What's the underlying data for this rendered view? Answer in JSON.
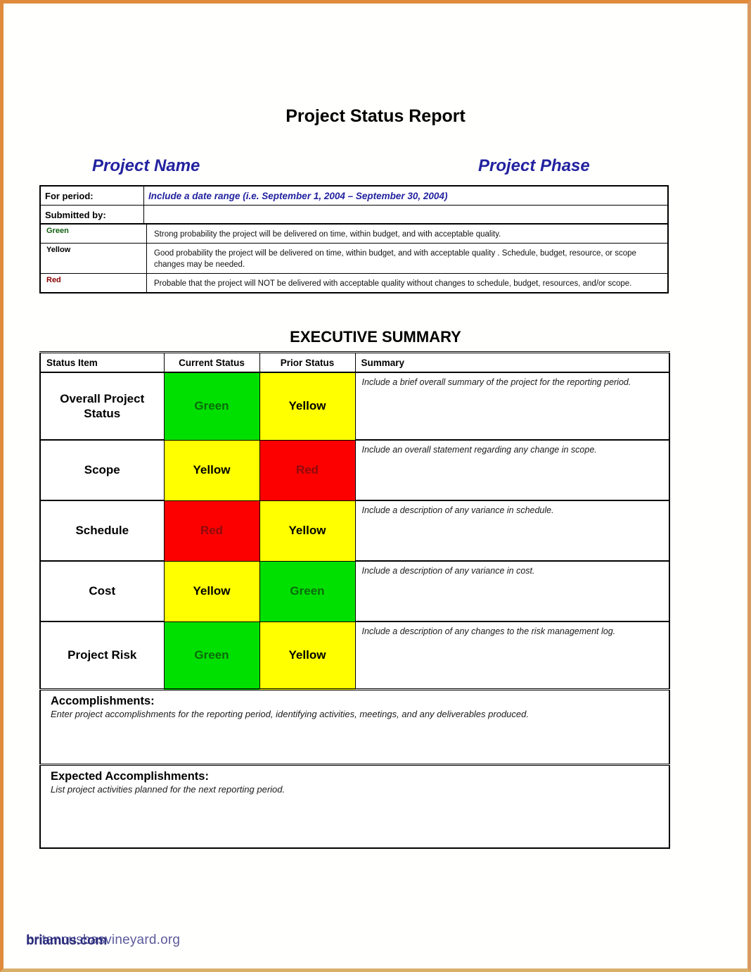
{
  "document": {
    "title": "Project Status Report",
    "project_name": "Project Name",
    "project_phase": "Project Phase"
  },
  "header_fields": [
    {
      "label": "For period:",
      "value": "Include a date range (i.e. September 1, 2004 – September 30, 2004)"
    },
    {
      "label": "Submitted by:",
      "value": ""
    }
  ],
  "legend": {
    "rows": [
      {
        "status": "Green",
        "color": "#00e000",
        "description": "Strong probability  the project will be delivered on time, within budget, and with acceptable quality."
      },
      {
        "status": "Yellow",
        "color": "#ffff00",
        "description": "Good probability the project will be delivered on time, within budget, and with acceptable quality . Schedule, budget, resource, or scope changes may be needed."
      },
      {
        "status": "Red",
        "color": "#fc0000",
        "description": "Probable that the project will NOT be delivered with acceptable quality without changes to schedule, budget, resources, and/or scope."
      }
    ]
  },
  "executive_summary": {
    "heading": "EXECUTIVE SUMMARY",
    "columns": [
      "Status Item",
      "Current Status",
      "Prior Status",
      "Summary"
    ],
    "rows": [
      {
        "item": "Overall Project Status",
        "current_status": "Green",
        "current_color": "#00e000",
        "prior_status": "Yellow",
        "prior_color": "#ffff00",
        "summary": "Include a brief overall summary of the project for the reporting period."
      },
      {
        "item": "Scope",
        "current_status": "Yellow",
        "current_color": "#ffff00",
        "prior_status": "Red",
        "prior_color": "#fc0000",
        "summary": "Include an overall statement regarding any change in scope."
      },
      {
        "item": "Schedule",
        "current_status": "Red",
        "current_color": "#fc0000",
        "prior_status": "Yellow",
        "prior_color": "#ffff00",
        "summary": "Include a description of any variance in schedule."
      },
      {
        "item": "Cost",
        "current_status": "Yellow",
        "current_color": "#ffff00",
        "prior_status": "Green",
        "prior_color": "#00e000",
        "summary": "Include a description of any variance in cost."
      },
      {
        "item": "Project Risk",
        "current_status": "Green",
        "current_color": "#00e000",
        "prior_status": "Yellow",
        "prior_color": "#ffff00",
        "summary": "Include a description of any changes to the risk management log."
      }
    ]
  },
  "accomplishments": {
    "heading": "Accomplishments:",
    "body": "Enter project accomplishments for the reporting period, identifying activities, meetings, and any deliverables produced."
  },
  "expected_accomplishments": {
    "heading": "Expected Accomplishments:",
    "body": "List project activities planned for the next reporting period."
  },
  "watermark": {
    "line_a": "briamus.com",
    "line_b": "britannusbasvineyard.org"
  }
}
